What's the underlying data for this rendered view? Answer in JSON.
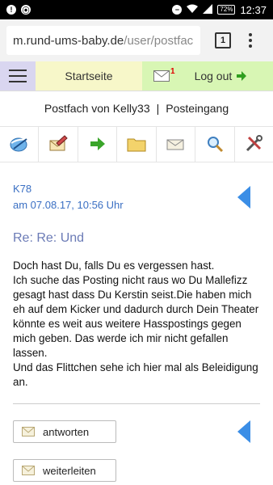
{
  "status_bar": {
    "time": "12:37",
    "battery": "72"
  },
  "browser": {
    "url_host": "m.rund-ums-baby.de",
    "url_path": "/user/postfac",
    "tab_count": "1"
  },
  "nav": {
    "home_label": "Startseite",
    "mail_badge": "1",
    "logout_label": "Log out"
  },
  "mailbox": {
    "title": "Postfach von Kelly33",
    "separator": "|",
    "folder": "Posteingang"
  },
  "toolbar": {
    "icons": [
      "refresh-globe-icon",
      "compose-icon",
      "forward-arrow-icon",
      "folder-icon",
      "envelope-icon",
      "search-icon",
      "settings-tools-icon"
    ]
  },
  "message": {
    "sender": "K78",
    "date": "am 07.08.17, 10:56 Uhr",
    "subject": "Re: Re: Und",
    "body": "Doch hast Du, falls Du es vergessen hast.\nIch suche das Posting nicht raus wo Du Mallefizz gesagt hast dass Du Kerstin seist.Die haben mich eh auf dem Kicker und dadurch durch Dein Theater könnte es weit aus weitere Hasspostings gegen mich geben. Das werde ich mir nicht gefallen lassen.\nUnd das Flittchen sehe ich hier mal als Beleidigung an."
  },
  "actions": {
    "reply_label": "antworten",
    "forward_label": "weiterleiten"
  },
  "colors": {
    "accent_blue": "#3b8ee6",
    "link_blue": "#3a6fc3",
    "subject_purple": "#6b7bb6",
    "nav_purple": "#d9d6f0",
    "nav_yellow": "#f7f7c9",
    "nav_green": "#d8f6b4"
  }
}
